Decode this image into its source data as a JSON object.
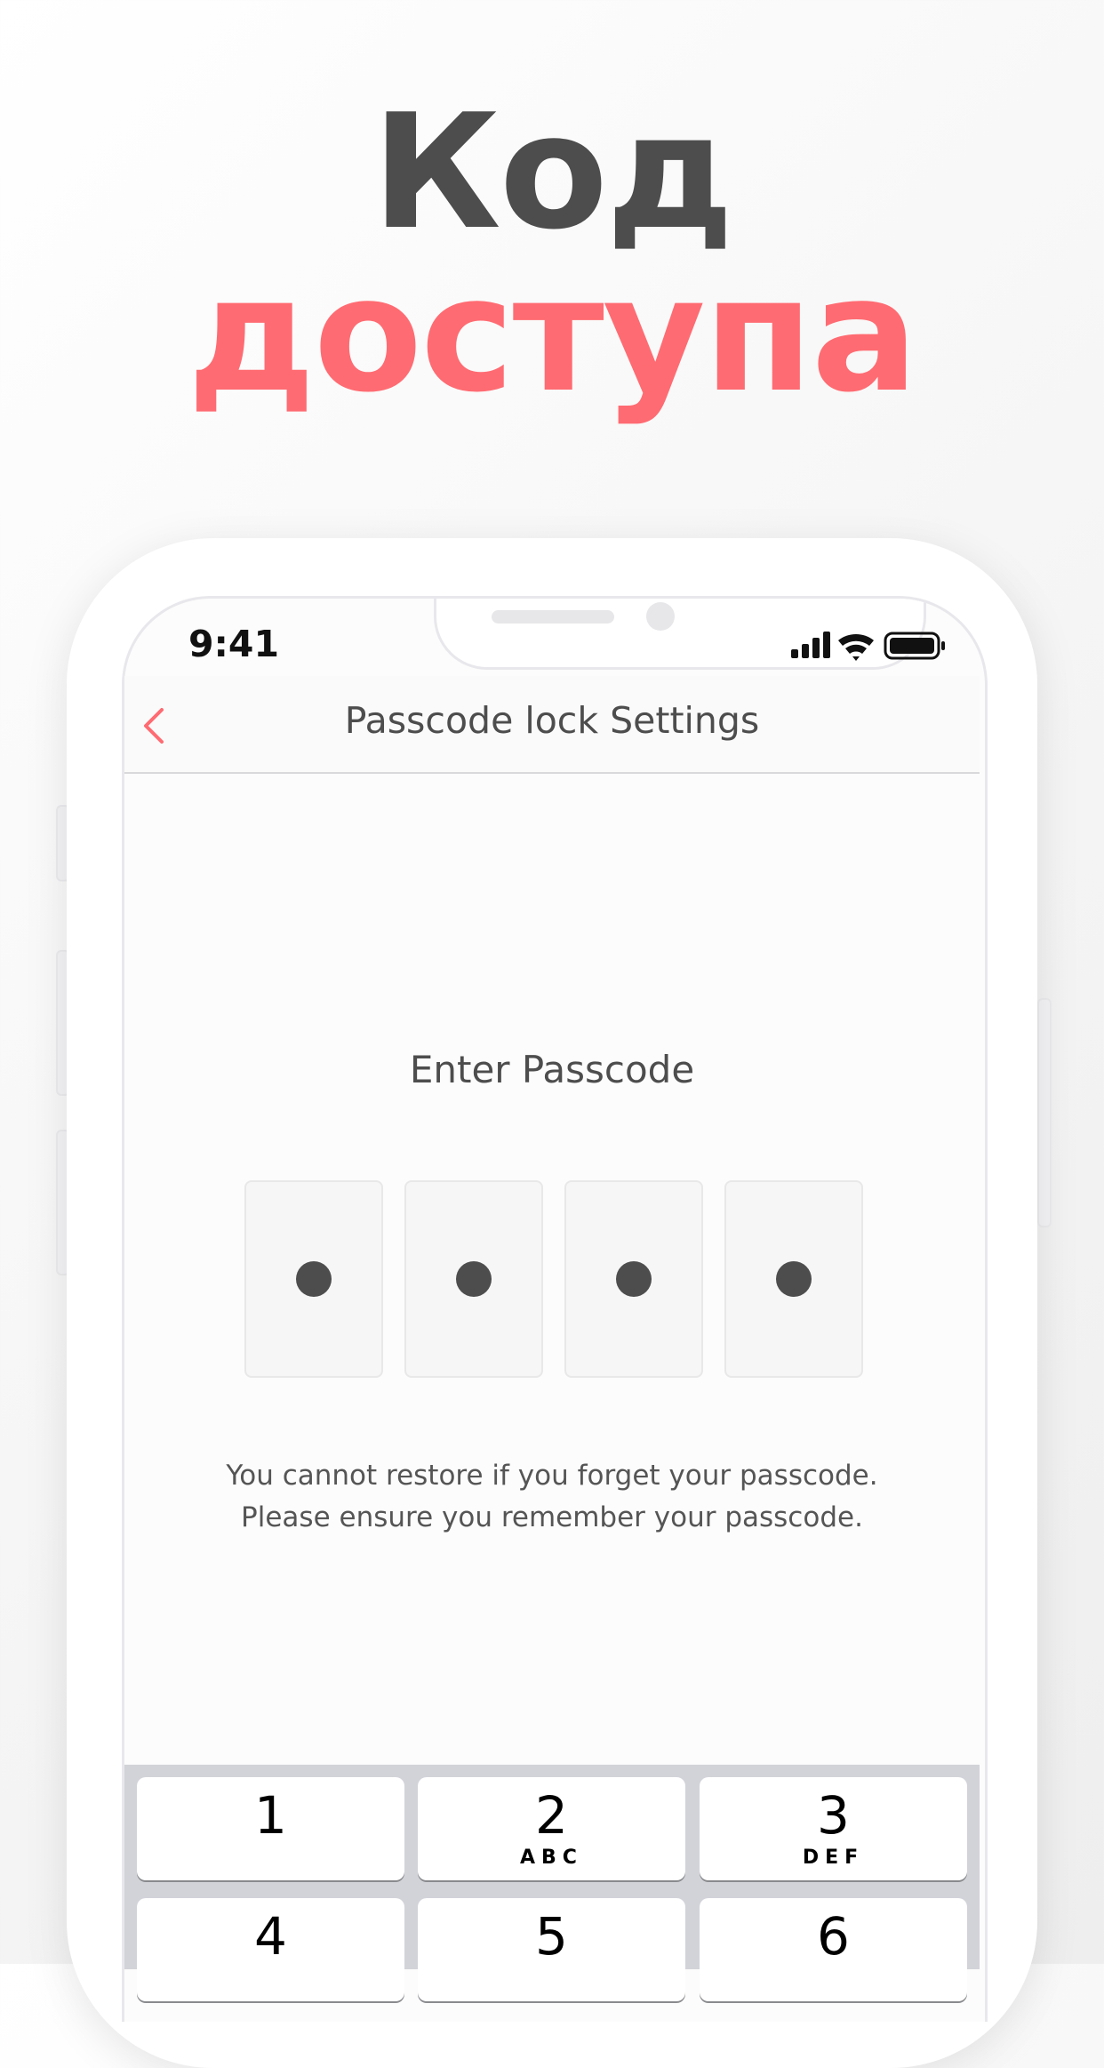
{
  "headline": {
    "line1": "Код",
    "line2": "доступа"
  },
  "status_bar": {
    "time": "9:41",
    "icons": [
      "cellular-signal-icon",
      "wifi-icon",
      "battery-icon"
    ]
  },
  "nav": {
    "title": "Passcode lock Settings",
    "back_icon": "chevron-left-icon"
  },
  "passcode": {
    "prompt": "Enter Passcode",
    "entered_digits": 4,
    "total_digits": 4
  },
  "warning": {
    "line1": "You cannot restore if you forget your passcode.",
    "line2": "Please ensure you remember your passcode."
  },
  "keypad": {
    "keys": [
      {
        "num": "1",
        "letters": ""
      },
      {
        "num": "2",
        "letters": "ABC"
      },
      {
        "num": "3",
        "letters": "DEF"
      },
      {
        "num": "4",
        "letters": ""
      },
      {
        "num": "5",
        "letters": ""
      },
      {
        "num": "6",
        "letters": ""
      }
    ]
  },
  "colors": {
    "accent": "#ff6b72",
    "text_dark": "#4d4d4d"
  }
}
